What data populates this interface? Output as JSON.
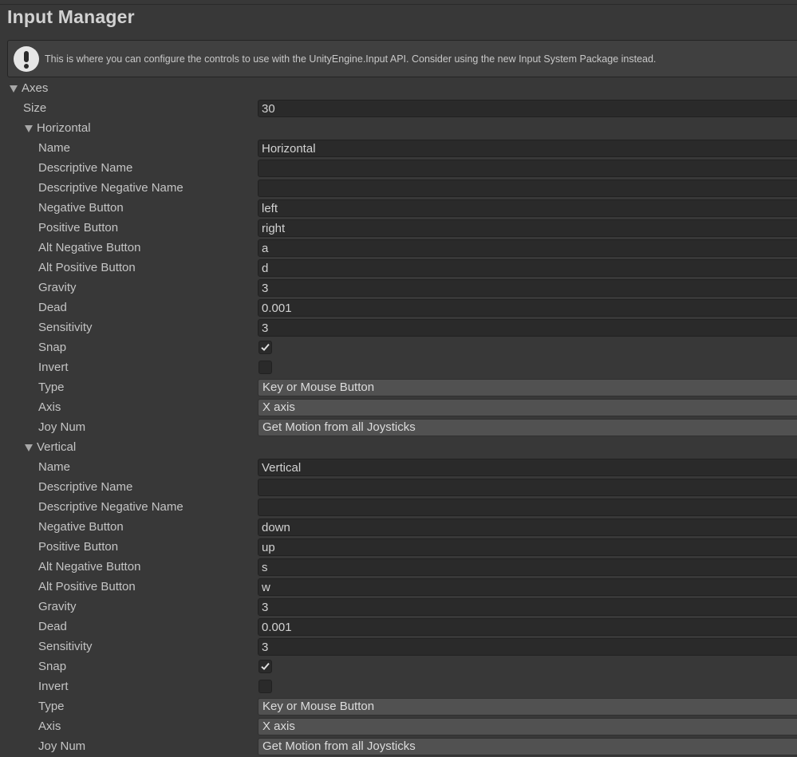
{
  "window": {
    "title": "Input Manager"
  },
  "help": {
    "icon": "warning-icon",
    "text": "This is where you can configure the controls to use with the UnityEngine.Input API. Consider using the new Input System Package instead."
  },
  "axes": {
    "label": "Axes",
    "size_label": "Size",
    "size_value": "30",
    "entries": [
      {
        "header": "Horizontal",
        "fields": {
          "name": {
            "label": "Name",
            "value": "Horizontal"
          },
          "descriptive_name": {
            "label": "Descriptive Name",
            "value": ""
          },
          "descriptive_negative_name": {
            "label": "Descriptive Negative Name",
            "value": ""
          },
          "negative_button": {
            "label": "Negative Button",
            "value": "left"
          },
          "positive_button": {
            "label": "Positive Button",
            "value": "right"
          },
          "alt_negative_button": {
            "label": "Alt Negative Button",
            "value": "a"
          },
          "alt_positive_button": {
            "label": "Alt Positive Button",
            "value": "d"
          },
          "gravity": {
            "label": "Gravity",
            "value": "3"
          },
          "dead": {
            "label": "Dead",
            "value": "0.001"
          },
          "sensitivity": {
            "label": "Sensitivity",
            "value": "3"
          },
          "snap": {
            "label": "Snap",
            "checked": true
          },
          "invert": {
            "label": "Invert",
            "checked": false
          },
          "type": {
            "label": "Type",
            "value": "Key or Mouse Button"
          },
          "axis": {
            "label": "Axis",
            "value": "X axis"
          },
          "joy_num": {
            "label": "Joy Num",
            "value": "Get Motion from all Joysticks"
          }
        }
      },
      {
        "header": "Vertical",
        "fields": {
          "name": {
            "label": "Name",
            "value": "Vertical"
          },
          "descriptive_name": {
            "label": "Descriptive Name",
            "value": ""
          },
          "descriptive_negative_name": {
            "label": "Descriptive Negative Name",
            "value": ""
          },
          "negative_button": {
            "label": "Negative Button",
            "value": "down"
          },
          "positive_button": {
            "label": "Positive Button",
            "value": "up"
          },
          "alt_negative_button": {
            "label": "Alt Negative Button",
            "value": "s"
          },
          "alt_positive_button": {
            "label": "Alt Positive Button",
            "value": "w"
          },
          "gravity": {
            "label": "Gravity",
            "value": "3"
          },
          "dead": {
            "label": "Dead",
            "value": "0.001"
          },
          "sensitivity": {
            "label": "Sensitivity",
            "value": "3"
          },
          "snap": {
            "label": "Snap",
            "checked": true
          },
          "invert": {
            "label": "Invert",
            "checked": false
          },
          "type": {
            "label": "Type",
            "value": "Key or Mouse Button"
          },
          "axis": {
            "label": "Axis",
            "value": "X axis"
          },
          "joy_num": {
            "label": "Joy Num",
            "value": "Get Motion from all Joysticks"
          }
        }
      }
    ]
  },
  "colors": {
    "background": "#383838",
    "field_bg": "#2a2a2a",
    "dropdown_bg": "#515151",
    "text": "#c4c4c4"
  }
}
